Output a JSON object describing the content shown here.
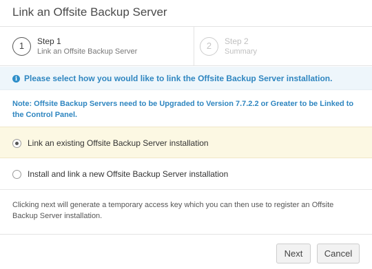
{
  "dialog": {
    "title": "Link an Offsite Backup Server"
  },
  "steps": [
    {
      "number": "1",
      "title": "Step 1",
      "subtitle": "Link an Offsite Backup Server",
      "state": "active"
    },
    {
      "number": "2",
      "title": "Step 2",
      "subtitle": "Summary",
      "state": "inactive"
    }
  ],
  "info": {
    "icon": "info-circle-icon",
    "text": "Please select how you would like to link the Offsite Backup Server installation."
  },
  "note": "Note: Offsite Backup Servers need to be Upgraded to Version 7.7.2.2 or Greater to be Linked to the Control Panel.",
  "options": [
    {
      "label": "Link an existing Offsite Backup Server installation",
      "selected": true
    },
    {
      "label": "Install and link a new Offsite Backup Server installation",
      "selected": false
    }
  ],
  "description": "Clicking next will generate a temporary access key which you can then use to register an Offsite Backup Server installation.",
  "buttons": {
    "next": "Next",
    "cancel": "Cancel"
  },
  "colors": {
    "accent": "#2f86c0",
    "selected_row": "#fcf8e3",
    "info_bar": "#eef6fb"
  }
}
